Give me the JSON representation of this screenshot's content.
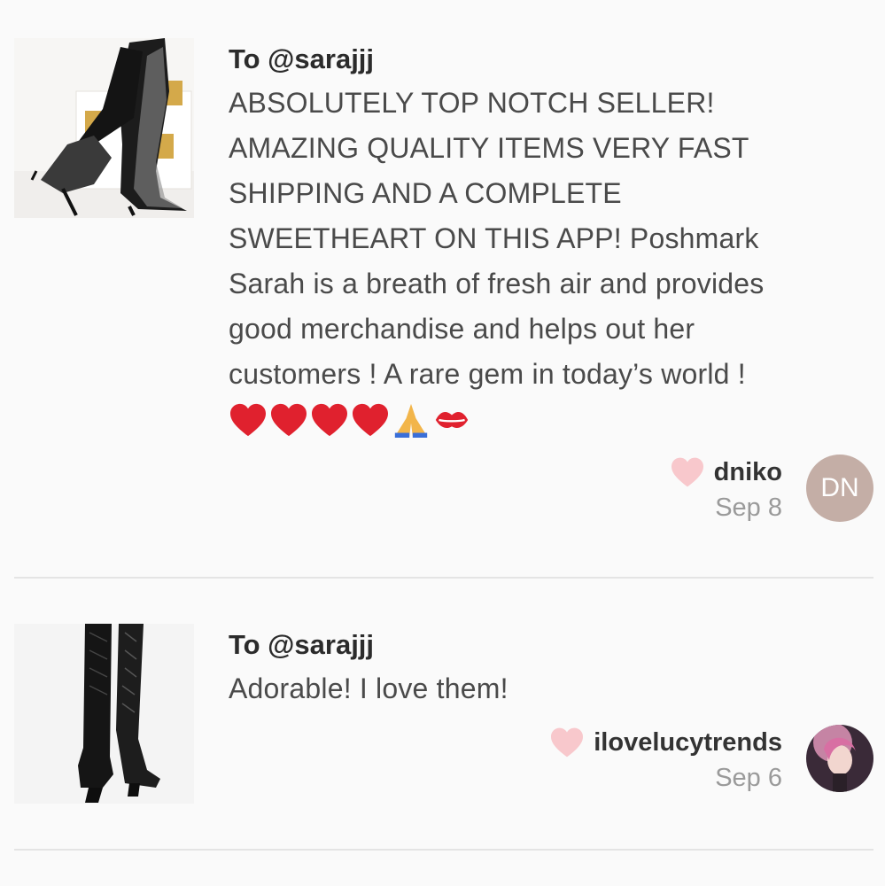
{
  "reviews": [
    {
      "to": "To @sarajjj",
      "lines": [
        "ABSOLUTELY TOP NOTCH SELLER!",
        "AMAZING QUALITY ITEMS VERY FAST",
        "SHIPPING AND A COMPLETE",
        "SWEETHEART ON THIS APP! Poshmark",
        "Sarah is a breath of fresh air and provides",
        "good merchandise and helps out her",
        "customers ! A rare gem in today’s world !"
      ],
      "emojis": [
        "red-heart",
        "red-heart",
        "red-heart",
        "red-heart",
        "folded-hands",
        "kiss-mark"
      ],
      "author": "dniko",
      "date": "Sep 8",
      "avatar_initials": "DN"
    },
    {
      "to": "To @sarajjj",
      "lines": [
        "Adorable! I love them!"
      ],
      "author": "ilovelucytrends",
      "date": "Sep 6"
    }
  ],
  "colors": {
    "like_heart": "#f8c8cc",
    "avatar_bg": "#c4aea6",
    "date_text": "#9a9a9a",
    "divider": "#e4e4e4"
  }
}
